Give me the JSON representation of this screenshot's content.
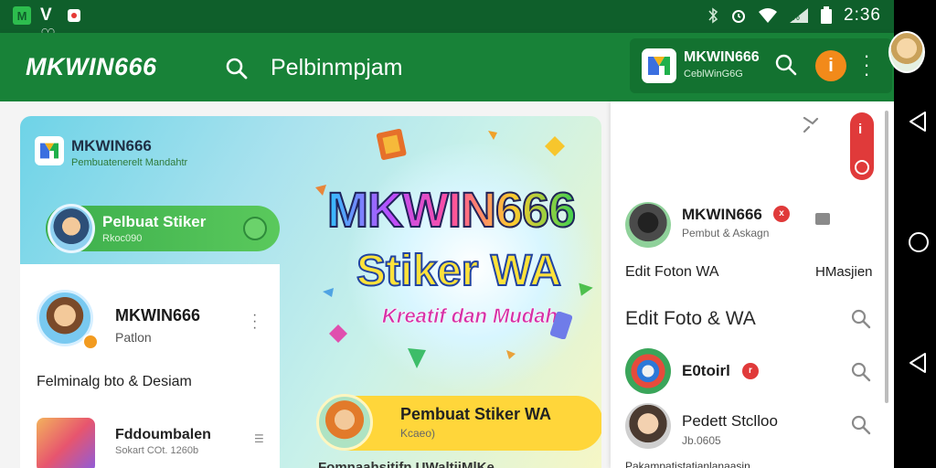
{
  "status_bar": {
    "left_icons": [
      "app-icon",
      "notification-icon",
      "voicemail-icon",
      "record-icon"
    ],
    "left_glyphs": [
      "M",
      "W V ♡",
      ""
    ],
    "time": "2:36",
    "right_icons": [
      "bluetooth-icon",
      "alarm-icon",
      "wifi-icon",
      "signal-icon",
      "battery-icon"
    ]
  },
  "app_bar": {
    "brand": "MKWIN666",
    "search_text": "Pelbinmpjam",
    "account": {
      "title": "MKWIN666",
      "subtitle": "CeblWinG6G",
      "alert_glyph": "i"
    },
    "accent": "#188238",
    "status_color": "#0f5f2b"
  },
  "banner": {
    "logo_title": "MKWIN666",
    "logo_subtitle": "Pembuatenerelt Mandahtr",
    "green_pill": {
      "title": "Pelbuat Stiker",
      "subtitle": "Rkoc090"
    },
    "headline_1": "MKWIN666",
    "headline_2": "Stiker WA",
    "headline_3": "Kreatif dan Mudah",
    "yellow_pill": {
      "title": "Pembuat Stiker WA",
      "subtitle": "Kcaeo)"
    },
    "bottom_text": "Fomnaahsitifn UWaltiiMlKe"
  },
  "profile_card": {
    "name": "MKWIN666",
    "subtitle": "Patlon",
    "line": "Felminalg bto & Desiam",
    "row": {
      "title": "Fddoumbalen",
      "subtitle": "Sokart COt. 1260b"
    }
  },
  "right_panel": {
    "items": [
      {
        "name": "MKWIN666",
        "sub": "Pembut & Askagn",
        "badge": "x"
      },
      {
        "text_left": "Edit Foton WA",
        "text_right": "HMasjien"
      },
      {
        "heading": "Edit Foto & WA"
      },
      {
        "name": "E0toirl",
        "badge": "r"
      },
      {
        "name": "Pedett Stclloo",
        "sub": "Jb.0605"
      }
    ],
    "bottom_text": "Pakampatistatianlanaasin"
  },
  "nav": {
    "buttons": [
      "back-icon",
      "home-icon",
      "back-icon"
    ]
  }
}
